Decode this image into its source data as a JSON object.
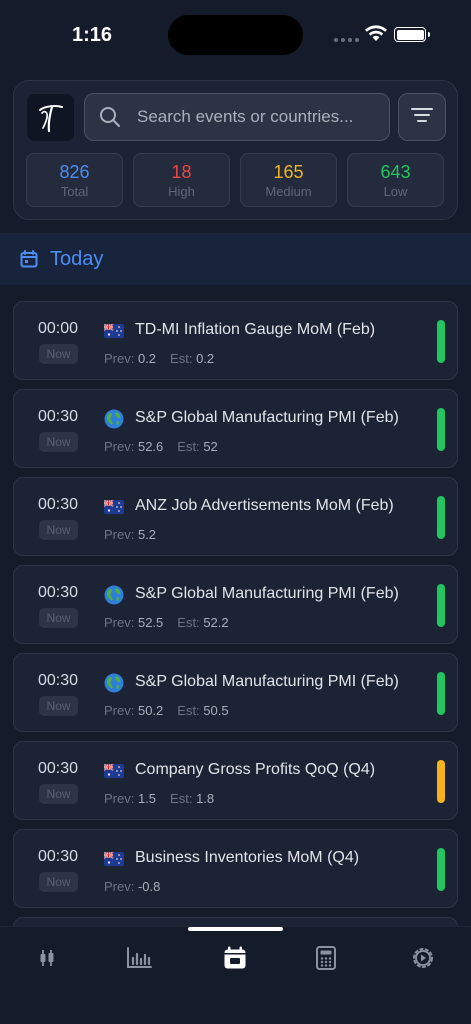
{
  "status": {
    "time": "1:16"
  },
  "search": {
    "placeholder": "Search events or countries..."
  },
  "stats": [
    {
      "value": "826",
      "label": "Total",
      "color": "#4b8df5"
    },
    {
      "value": "18",
      "label": "High",
      "color": "#ef4444"
    },
    {
      "value": "165",
      "label": "Medium",
      "color": "#f5b31e"
    },
    {
      "value": "643",
      "label": "Low",
      "color": "#22c55e"
    }
  ],
  "section": {
    "title": "Today"
  },
  "events": [
    {
      "time": "00:00",
      "badge": "Now",
      "flag": "au-flag-icon",
      "name": "TD-MI Inflation Gauge MoM (Feb)",
      "prev_label": "Prev:",
      "prev": "0.2",
      "est_label": "Est:",
      "est": "0.2",
      "impact": "low",
      "impact_color": "#22c55e"
    },
    {
      "time": "00:30",
      "badge": "Now",
      "flag": "globe-icon",
      "name": "S&P Global Manufacturing PMI (Feb)",
      "prev_label": "Prev:",
      "prev": "52.6",
      "est_label": "Est:",
      "est": "52",
      "impact": "low",
      "impact_color": "#22c55e"
    },
    {
      "time": "00:30",
      "badge": "Now",
      "flag": "au-flag-icon",
      "name": "ANZ Job Advertisements MoM (Feb)",
      "prev_label": "Prev:",
      "prev": "5.2",
      "est_label": "",
      "est": "",
      "impact": "low",
      "impact_color": "#22c55e"
    },
    {
      "time": "00:30",
      "badge": "Now",
      "flag": "globe-icon",
      "name": "S&P Global Manufacturing PMI (Feb)",
      "prev_label": "Prev:",
      "prev": "52.5",
      "est_label": "Est:",
      "est": "52.2",
      "impact": "low",
      "impact_color": "#22c55e"
    },
    {
      "time": "00:30",
      "badge": "Now",
      "flag": "globe-icon",
      "name": "S&P Global Manufacturing PMI (Feb)",
      "prev_label": "Prev:",
      "prev": "50.2",
      "est_label": "Est:",
      "est": "50.5",
      "impact": "low",
      "impact_color": "#22c55e"
    },
    {
      "time": "00:30",
      "badge": "Now",
      "flag": "au-flag-icon",
      "name": "Company Gross Profits QoQ (Q4)",
      "prev_label": "Prev:",
      "prev": "1.5",
      "est_label": "Est:",
      "est": "1.8",
      "impact": "medium",
      "impact_color": "#f5b31e"
    },
    {
      "time": "00:30",
      "badge": "Now",
      "flag": "au-flag-icon",
      "name": "Business Inventories MoM (Q4)",
      "prev_label": "Prev:",
      "prev": "-0.8",
      "est_label": "",
      "est": "",
      "impact": "low",
      "impact_color": "#22c55e"
    }
  ],
  "nav": [
    {
      "icon": "candlestick-icon",
      "active": false
    },
    {
      "icon": "bar-chart-icon",
      "active": false
    },
    {
      "icon": "calendar-icon",
      "active": true
    },
    {
      "icon": "calculator-icon",
      "active": false
    },
    {
      "icon": "settings-icon",
      "active": false
    }
  ]
}
